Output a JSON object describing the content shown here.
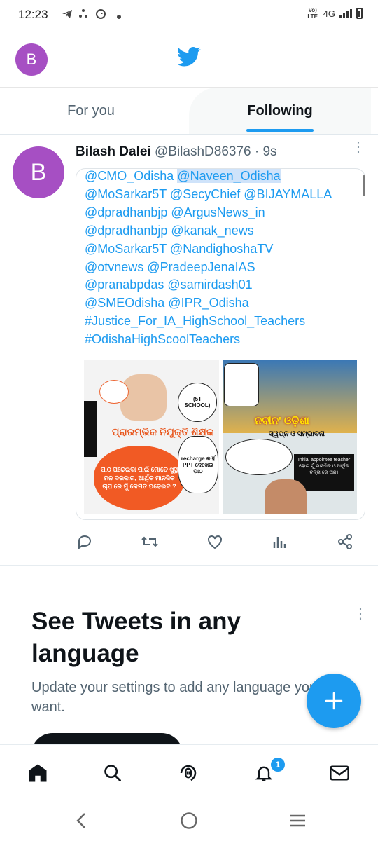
{
  "status_bar": {
    "time": "12:23",
    "network_label": "4G",
    "volte_label": "Vo) LTE"
  },
  "header": {
    "avatar_letter": "B"
  },
  "tabs": [
    {
      "label": "For you",
      "selected": false
    },
    {
      "label": "Following",
      "selected": true
    }
  ],
  "tweet": {
    "avatar_letter": "B",
    "author_name": "Bilash Dalei",
    "author_handle": "@BilashD86376",
    "separator": " · ",
    "time": "9s",
    "text_lines": [
      {
        "before": "@CMO_Odisha ",
        "highlight": "@Naveen_Odisha"
      },
      "@MoSarkar5T @SecyChief @BIJAYMALLA",
      "@dpradhanbjp @ArgusNews_in",
      "@dpradhanbjp @kanak_news",
      "@MoSarkar5T @NandighoshaTV",
      "@otvnews @PradeepJenaIAS",
      "@pranabpdas @samirdash01",
      "@SMEOdisha @IPR_Odisha",
      "#Justice_For_IA_HighSchool_Teachers",
      "#OdishaHighScoolTeachers"
    ],
    "image1": {
      "title": "ପ୍ରାରମ୍ଭିକ ନିଯୁକ୍ତି ଶିକ୍ଷକ",
      "burst": "ପାଠ ପଢେଇବା ପାଇଁ ମୋତେ ସୁସ୍ଥ ମନ ଦରକାର, ଆର୍ଥିକ ମାନସିକ ଚାପ ରେ ମୁଁ କେମିତି ପଢେଇବି ?",
      "bubble_school": "(5T SCHOOL)",
      "bubble_recharge": "recharge କାହିଁ PPT ଦେଖେଇ ପାଠ"
    },
    "image2": {
      "title": "ନବୀନ' ଓଡ଼ିଶା",
      "subtitle": "ସ୍ୱପ୍ନ ଓ ସମ୍ଭାବନା",
      "box": "Initial appointee teacher ହୋଇ ମୁଁ ମାନସିକ ଓ ଆର୍ଥିକ ଚିନ୍ତା ରେ ଅଛି।"
    }
  },
  "promo": {
    "title": "See Tweets in any language",
    "body": "Update your settings to add any language you want."
  },
  "notifications_badge": "1",
  "colors": {
    "accent": "#1d9bf0",
    "avatar": "#a64fc3",
    "text": "#0f1419",
    "muted": "#536471"
  },
  "icons": [
    "home-icon",
    "search-icon",
    "spaces-icon",
    "notifications-icon",
    "messages-icon",
    "reply-icon",
    "retweet-icon",
    "like-icon",
    "views-icon",
    "share-icon",
    "compose-icon"
  ]
}
